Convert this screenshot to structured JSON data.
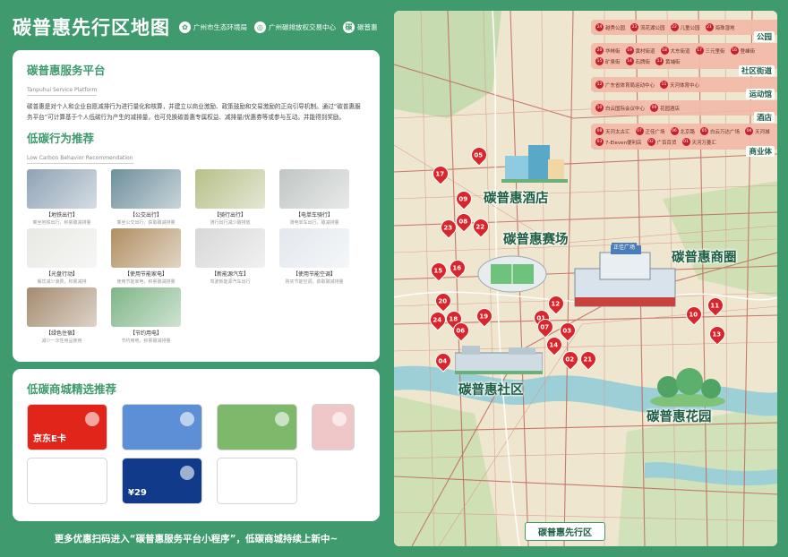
{
  "header": {
    "title": "碳普惠先行区地图",
    "logos": [
      {
        "icon": "leaf-logo-icon",
        "text": "广州市生态环境局"
      },
      {
        "icon": "exchange-logo-icon",
        "text": "广州碳排放权交易中心"
      },
      {
        "icon": "platform-logo-icon",
        "text": "碳普惠"
      }
    ]
  },
  "platform": {
    "title": "碳普惠服务平台",
    "subtitle": "Tanpuhui Service Platform",
    "description": "碳普惠是对个人和企业自愿减排行为进行量化和核算，并建立以商业激励、政策鼓励和交易激励的正向引导机制。通过“碳普惠服务平台”可计算基于个人低碳行为产生的减排量，也可兑换碳普惠专属权益、减排量/优惠券等或参与互动。并能得到奖励。"
  },
  "behaviors": {
    "title": "低碳行为推荐",
    "subtitle": "Low Carbon Behavior Recommendation",
    "items": [
      {
        "label": "【地铁出行】",
        "caption": "乘坐地铁出行，积累碳减排量",
        "theme": "#8fa3b5"
      },
      {
        "label": "【公交出行】",
        "caption": "乘坐公交出行，获取碳减排量",
        "theme": "#6e8f9c"
      },
      {
        "label": "【骑行出行】",
        "caption": "骑行出行减少碳排放",
        "theme": "#b7c08a"
      },
      {
        "label": "【电单车骑行】",
        "caption": "骑电单车出行，碳减排量",
        "theme": "#c0c6c4"
      },
      {
        "label": "【光盘行动】",
        "caption": "餐饮减少浪费，积累减排",
        "theme": "#e8e8e4"
      },
      {
        "label": "【使用节能家电】",
        "caption": "使用节能家电，积累碳减排量",
        "theme": "#b08f62"
      },
      {
        "label": "【新能源汽车】",
        "caption": "驾驶新能源汽车出行",
        "theme": "#d8d8d8"
      },
      {
        "label": "【使用节能空调】",
        "caption": "购买节能空调，获取碳减排量",
        "theme": "#e3e8ee"
      },
      {
        "label": "【绿色住宿】",
        "caption": "减少一次性用品使用",
        "theme": "#a58b6f"
      },
      {
        "label": "【节约用电】",
        "caption": "节约用电，积累碳减排量",
        "theme": "#7fb587"
      }
    ]
  },
  "mall": {
    "title": "低碳商城精选推荐",
    "items": [
      {
        "name": "京东E卡",
        "icon": "jd-card-icon",
        "theme": "#e1251b"
      },
      {
        "name": "",
        "icon": "car-wash-icon",
        "theme": "#5d8fd6"
      },
      {
        "name": "",
        "icon": "travel-icon",
        "theme": "#7db86b"
      },
      {
        "name": "",
        "icon": "shopping-cart-icon",
        "theme": "#efc7c9"
      },
      {
        "name": "",
        "icon": "seven-eleven-icon",
        "theme": "#ffffff"
      },
      {
        "name": "¥29",
        "icon": "coffee-cup-icon",
        "theme": "#123a8a"
      },
      {
        "name": "",
        "icon": "qr-code-icon",
        "theme": "#ffffff"
      }
    ]
  },
  "footer": {
    "text": "更多优惠扫码进入“碳普惠服务平台小程序”，低碳商城持续上新中~"
  },
  "map": {
    "zones": [
      {
        "name": "碳普惠酒店"
      },
      {
        "name": "碳普惠赛场"
      },
      {
        "name": "碳普惠商圈"
      },
      {
        "name": "碳普惠社区"
      },
      {
        "name": "碳普惠花园"
      }
    ],
    "mall_sign": "正佳广场",
    "bottom_label": "碳普惠先行区",
    "pins": [
      "05",
      "17",
      "09",
      "08",
      "22",
      "23",
      "15",
      "16",
      "20",
      "24",
      "18",
      "06",
      "19",
      "01",
      "12",
      "07",
      "03",
      "14",
      "02",
      "21",
      "04",
      "10",
      "11",
      "13"
    ],
    "legend": [
      {
        "category": "公园",
        "items": [
          {
            "no": "24",
            "label": "越秀公园"
          },
          {
            "no": "23",
            "label": "流花湖公园"
          },
          {
            "no": "22",
            "label": "儿童公园"
          },
          {
            "no": "21",
            "label": "海珠湿地"
          }
        ]
      },
      {
        "category": "社区街道",
        "items": [
          {
            "no": "20",
            "label": "华林街"
          },
          {
            "no": "19",
            "label": "黄村街道"
          },
          {
            "no": "18",
            "label": "大东街道"
          },
          {
            "no": "17",
            "label": "三元里街"
          },
          {
            "no": "16",
            "label": "登峰街"
          },
          {
            "no": "15",
            "label": "矿泉街"
          },
          {
            "no": "14",
            "label": "石牌街"
          },
          {
            "no": "13",
            "label": "黄埔街"
          }
        ]
      },
      {
        "category": "运动馆",
        "items": [
          {
            "no": "12",
            "label": "广东省体育局运动中心"
          },
          {
            "no": "11",
            "label": "天河体育中心"
          }
        ]
      },
      {
        "category": "酒店",
        "items": [
          {
            "no": "10",
            "label": "白云国际会议中心"
          },
          {
            "no": "09",
            "label": "花园酒店"
          }
        ]
      },
      {
        "category": "商业体",
        "items": [
          {
            "no": "08",
            "label": "天河太古汇"
          },
          {
            "no": "07",
            "label": "正佳广场"
          },
          {
            "no": "06",
            "label": "北京路"
          },
          {
            "no": "05",
            "label": "白云万达广场"
          },
          {
            "no": "04",
            "label": "天河城"
          },
          {
            "no": "03",
            "label": "7-Eleven便利店"
          },
          {
            "no": "02",
            "label": "广百百货"
          },
          {
            "no": "01",
            "label": "天河万菱汇"
          }
        ]
      }
    ]
  }
}
